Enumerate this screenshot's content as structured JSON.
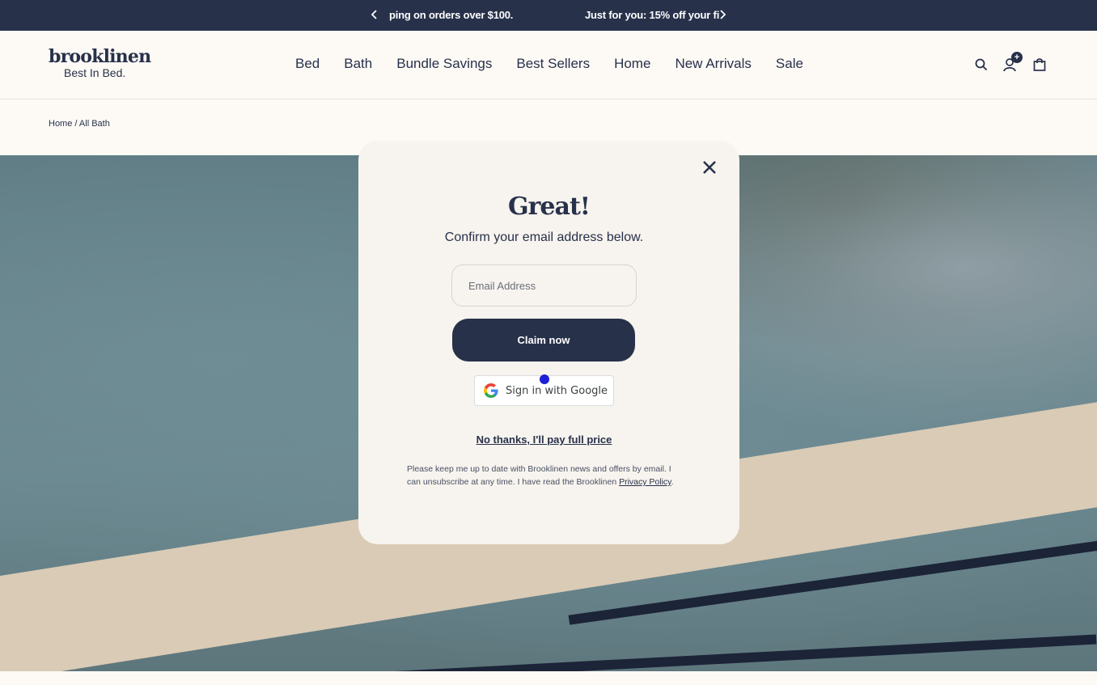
{
  "promo": {
    "message_1": "ping on orders over $100.",
    "message_2": "Just for you: 15% off your fi",
    "prev_icon": "chevron-left-icon",
    "next_icon": "chevron-right-icon"
  },
  "header": {
    "logo_word": "brooklinen",
    "logo_tagline": "Best In Bed.",
    "nav": [
      "Bed",
      "Bath",
      "Bundle Savings",
      "Best Sellers",
      "Home",
      "New Arrivals",
      "Sale"
    ],
    "icons": [
      "search-icon",
      "account-icon",
      "bag-icon"
    ],
    "account_badge": "+"
  },
  "breadcrumb": {
    "home": "Home",
    "separator": "/",
    "current": "All Bath"
  },
  "modal": {
    "title": "Great!",
    "subtitle": "Confirm your email address below.",
    "email_placeholder": "Email Address",
    "claim_label": "Claim now",
    "google_label": "Sign in with Google",
    "no_thanks": "No thanks, I'll pay full price",
    "legal_text": "Please keep me up to date with Brooklinen news and offers by email. I can unsubscribe at any time. I have read the Brooklinen ",
    "privacy_link": "Privacy Policy",
    "legal_end": "."
  },
  "colors": {
    "navy": "#27314a",
    "cream": "#fdf9f5",
    "modal_bg": "#f7f3ee"
  }
}
